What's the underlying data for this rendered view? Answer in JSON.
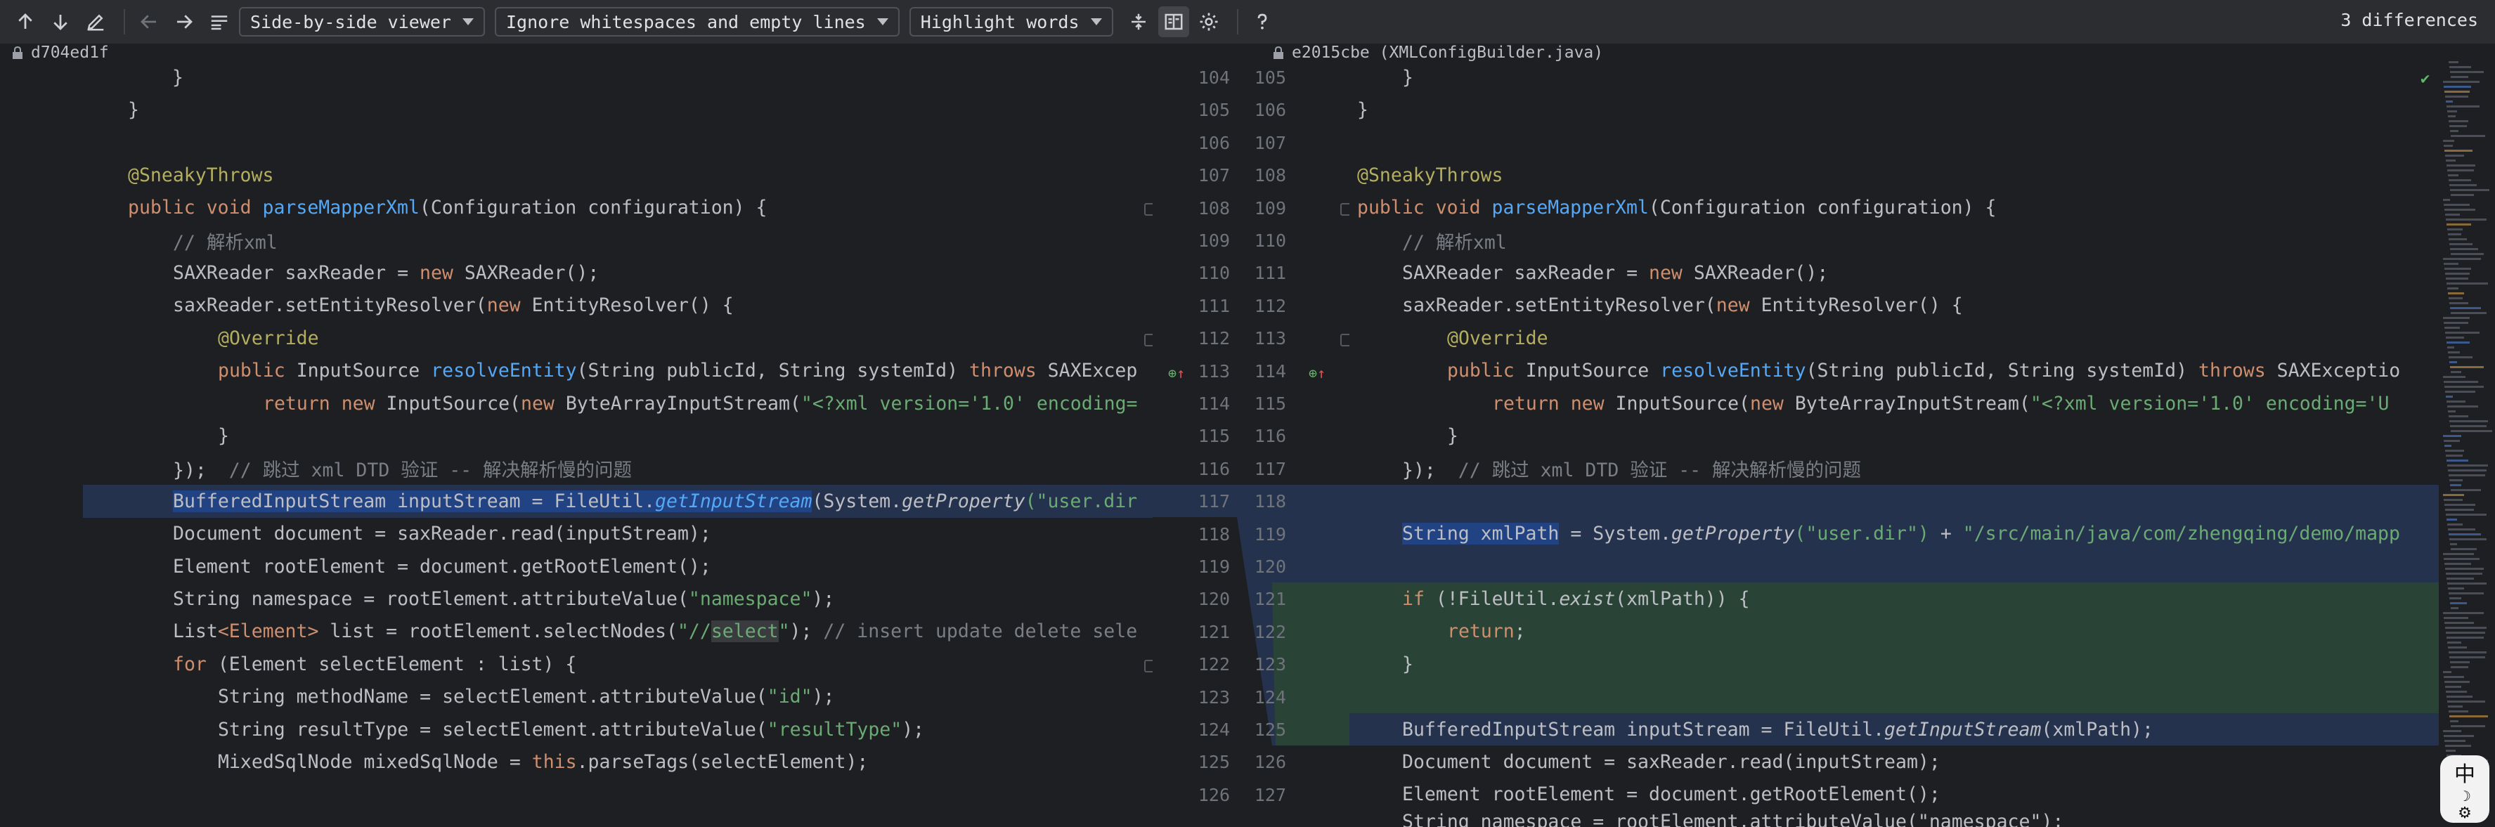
{
  "toolbar": {
    "viewer_mode": "Side-by-side viewer",
    "whitespace_mode": "Ignore whitespaces and empty lines",
    "highlight_mode": "Highlight words",
    "diff_count": "3 differences"
  },
  "titles": {
    "left": "d704ed1f",
    "right": "e2015cbe (XMLConfigBuilder.java)"
  },
  "left_lines": {
    "l104": "104",
    "l105": "105",
    "l106": "106",
    "l107": "107",
    "l108": "108",
    "l109": "109",
    "l110": "110",
    "l111": "111",
    "l112": "112",
    "l113": "113",
    "l114": "114",
    "l115": "115",
    "l116": "116",
    "l117": "117",
    "l118": "118",
    "l119": "119",
    "l120": "120",
    "l121": "121",
    "l122": "122",
    "l123": "123",
    "l124": "124",
    "l125": "125",
    "l126": "126"
  },
  "right_lines": {
    "r105": "105",
    "r106": "106",
    "r107": "107",
    "r108": "108",
    "r109": "109",
    "r110": "110",
    "r111": "111",
    "r112": "112",
    "r113": "113",
    "r114": "114",
    "r115": "115",
    "r116": "116",
    "r117": "117",
    "r118": "118",
    "r119": "119",
    "r120": "120",
    "r121": "121",
    "r122": "122",
    "r123": "123",
    "r124": "124",
    "r125": "125",
    "r126": "126",
    "r127": "127"
  },
  "code": {
    "brace_close_inner": "}",
    "brace_close_outer": "}",
    "annotation_sneaky": "@SneakyThrows",
    "kw_public": "public",
    "kw_void": "void",
    "fn_parse": "parseMapperXml",
    "parse_params": "(Configuration configuration) {",
    "comment_parse_xml": "// 解析xml",
    "sax_decl": "SAXReader saxReader = ",
    "kw_new": "new",
    "sax_ctor": " SAXReader();",
    "set_resolver": "saxReader.setEntityResolver(",
    "entity_resolver": " EntityResolver() {",
    "annotation_override": "@Override",
    "input_source": " InputSource ",
    "fn_resolve": "resolveEntity",
    "resolve_params": "(String publicId, String systemId) ",
    "kw_throws": "throws",
    "sax_exc_left": " SAXExcep",
    "sax_exc_right": " SAXExceptio",
    "kw_return": "return",
    "input_source_ctor": " InputSource(",
    "byte_stream": " ByteArrayInputStream(",
    "xml_decl_left": "\"<?xml version='1.0' encoding=",
    "xml_decl_right": "\"<?xml version='1.0' encoding='U",
    "close_brace": "}",
    "close_resolver": "});",
    "comment_dtd": "  // 跳过 xml DTD 验证 -- 解决解析慢的问题",
    "buffered_decl": "BufferedInputStream inputStream = ",
    "fileutil_dot": "FileUtil.",
    "fn_get_input_stream": "getInputStream",
    "system_get_left": "(System.",
    "fn_get_property": "getProperty",
    "user_dir_left": "(\"user.dir",
    "doc_decl": "Document document = saxReader.read(inputStream);",
    "root_decl": "Element rootElement = document.getRootElement();",
    "ns_decl": "String namespace = rootElement.attributeValue(",
    "ns_arg": "\"namespace\"",
    "ns_end": ");",
    "list_decl_a": "List",
    "list_decl_b": "<Element>",
    "list_decl_c": " list = rootElement.selectNodes(",
    "select_str_a": "\"//",
    "select_str_b": "select",
    "select_str_c": "\"",
    "list_end": ");",
    "comment_insert": " // insert update delete sele",
    "kw_for": "for",
    "for_body": " (Element selectElement : list) {",
    "method_decl": "String methodName = selectElement.attributeValue(",
    "id_arg": "\"id\"",
    "result_decl": "String resultType = selectElement.attributeValue(",
    "result_arg": "\"resultType\"",
    "mixed_decl": "MixedSqlNode mixedSqlNode = ",
    "kw_this": "this",
    "parse_tags": ".parseTags(selectElement);",
    "xmlpath_decl": "String xmlPath",
    "xmlpath_eq": " = System.",
    "user_dir_right": "(\"user.dir\")",
    "plus": " + ",
    "path_str": "\"/src/main/java/com/zhengqing/demo/mapp",
    "kw_if": "if",
    "if_open": " (!FileUtil.",
    "fn_exist": "exist",
    "if_close": "(xmlPath)) {",
    "return_semi": ";",
    "xml_path_arg": "(xmlPath);",
    "doc_decl_right": "Document document = saxReader.read(inputStream);",
    "root_decl_right": "Element rootElement = document.getRootElement();",
    "last_partial": "String namespace = rootElement.attributeValue(\"namespace\");"
  },
  "ime": {
    "char1": "中",
    "char2": "☽",
    "char3": "⚙"
  }
}
